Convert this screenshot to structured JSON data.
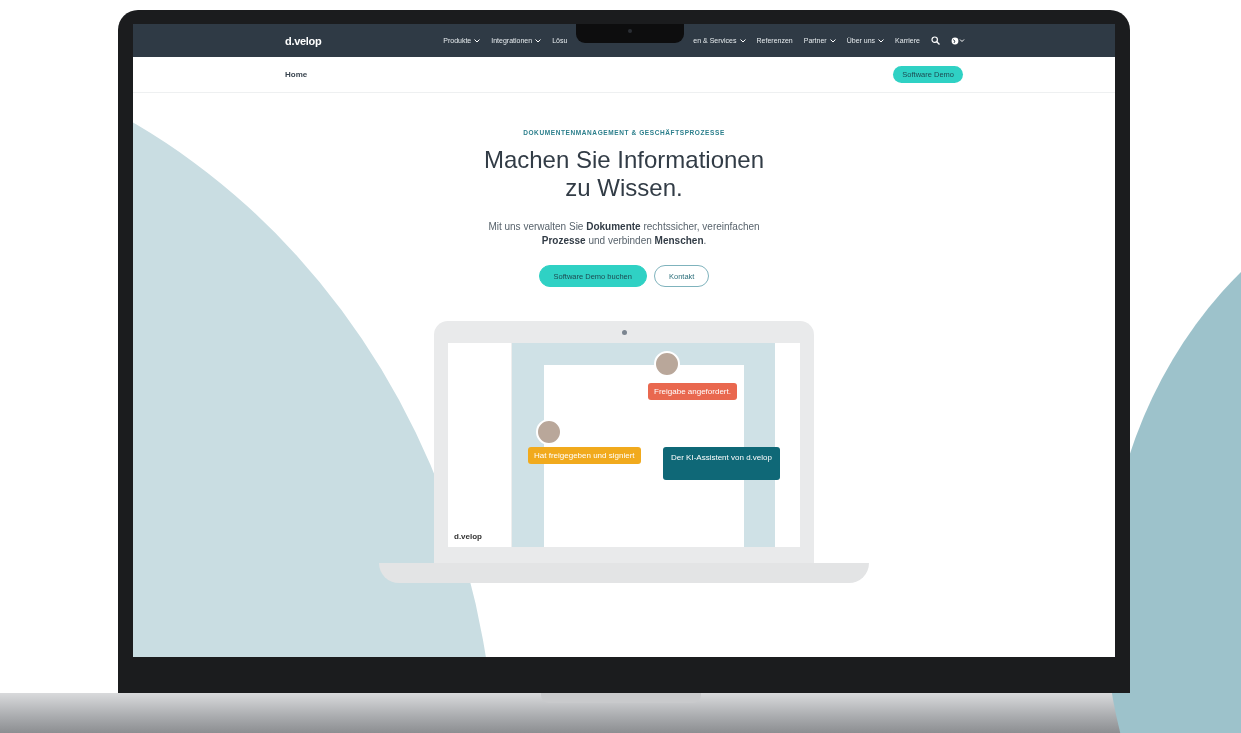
{
  "nav": {
    "logo": "d.velop",
    "items": [
      {
        "label": "Produkte",
        "dropdown": true
      },
      {
        "label": "Integrationen",
        "dropdown": true
      },
      {
        "label": "Lösu",
        "dropdown": false
      },
      {
        "label": "en & Services",
        "dropdown": true
      },
      {
        "label": "Referenzen",
        "dropdown": false
      },
      {
        "label": "Partner",
        "dropdown": true
      },
      {
        "label": "Über uns",
        "dropdown": true
      },
      {
        "label": "Karriere",
        "dropdown": false
      }
    ]
  },
  "breadcrumb": {
    "label": "Home",
    "button": "Software Demo"
  },
  "hero": {
    "eyebrow": "DOKUMENTENMANAGEMENT & GESCHÄFTSPROZESSE",
    "title": "Machen Sie Informationen zu Wissen.",
    "text": "Mit uns verwalten Sie **Dokumente** rechtssicher, vereinfachen **Prozesse** und verbinden **Menschen**.",
    "buttons": [
      {
        "label": "Software Demo buchen",
        "kind": "primary"
      },
      {
        "label": "Kontakt",
        "kind": "outline"
      }
    ]
  },
  "illustration": {
    "logo": "d.velop",
    "callouts": [
      {
        "kind": "request",
        "text": "Freigabe angefordert."
      },
      {
        "kind": "signed",
        "text": "Hat freigegeben und signiert"
      },
      {
        "kind": "assistant",
        "text": "Der KI-Assistent von d.velop"
      }
    ]
  }
}
